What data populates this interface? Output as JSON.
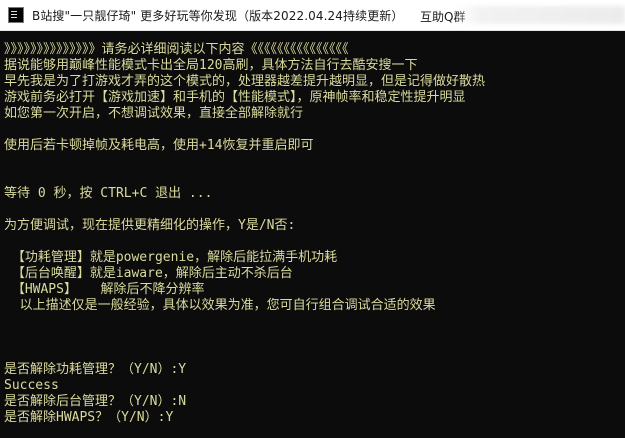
{
  "window": {
    "title": "B站搜\"一只靓仔琦\" 更多好玩等你发现（版本2022.04.24持续更新）",
    "title_right": "互助Q群"
  },
  "console": {
    "lines": [
      "》》》》》》》》》》》》》》请务必详细阅读以下内容《《《《《《《《《《《《《《《",
      "据说能够用巅峰性能模式卡出全局120高刷，具体方法自行去酷安搜一下",
      "早先我是为了打游戏才弄的这个模式的，处理器越差提升越明显，但是记得做好散热",
      "游戏前务必打开【游戏加速】和手机的【性能模式】，原神帧率和稳定性提升明显",
      "如您第一次开启，不想调试效果，直接全部解除就行",
      "使用后若卡顿掉帧及耗电高，使用+14恢复并重启即可",
      "等待 0 秒，按 CTRL+C 退出 ...",
      "为方便调试，现在提供更精细化的操作，Y是/N否:",
      " 【功耗管理】就是powergenie，解除后能拉满手机功耗",
      " 【后台唤醒】就是iaware，解除后主动不杀后台",
      " 【HWAPS】   解除后不降分辨率",
      "  以上描述仅是一般经验，具体以效果为准，您可自行组合调试合适的效果",
      "是否解除功耗管理？（Y/N）:Y",
      "Success",
      "是否解除后台管理？（Y/N）:N",
      "是否解除HWAPS？（Y/N）:Y"
    ]
  },
  "colors": {
    "console_bg": "#0c0c0c",
    "console_text": "#dada9e",
    "titlebar_bg": "#ffffff"
  },
  "icons": {
    "app": "console-app-icon"
  }
}
